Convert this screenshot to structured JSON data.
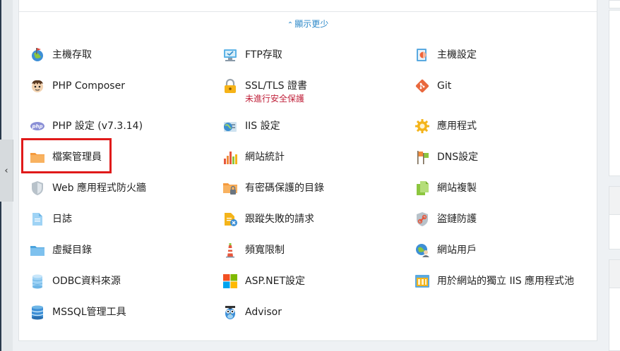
{
  "show_less": {
    "label": "顯示更少",
    "icon": "chevron-up-icon"
  },
  "collapse_icon": "chevron-left-icon",
  "items": [
    {
      "key": "hosting-access",
      "label": "主機存取",
      "icon": "globe-flag-icon"
    },
    {
      "key": "ftp-access",
      "label": "FTP存取",
      "icon": "ftp-monitor-icon"
    },
    {
      "key": "hosting-settings",
      "label": "主機設定",
      "icon": "server-settings-icon"
    },
    {
      "key": "php-composer",
      "label": "PHP Composer",
      "icon": "composer-icon"
    },
    {
      "key": "ssl-tls",
      "label": "SSL/TLS 證書",
      "sublabel": "未進行安全保護",
      "icon": "lock-icon"
    },
    {
      "key": "git",
      "label": "Git",
      "icon": "git-icon"
    },
    {
      "key": "php-settings",
      "label": "PHP 設定 (v7.3.14)",
      "icon": "php-icon"
    },
    {
      "key": "iis-settings",
      "label": "IIS 設定",
      "icon": "iis-icon"
    },
    {
      "key": "applications",
      "label": "應用程式",
      "icon": "gear-icon"
    },
    {
      "key": "file-manager",
      "label": "檔案管理員",
      "icon": "folder-icon"
    },
    {
      "key": "web-statistics",
      "label": "網站統計",
      "icon": "bar-chart-icon"
    },
    {
      "key": "dns-settings",
      "label": "DNS設定",
      "icon": "dns-flags-icon"
    },
    {
      "key": "web-app-firewall",
      "label": "Web 應用程式防火牆",
      "icon": "shield-icon"
    },
    {
      "key": "password-protected-dirs",
      "label": "有密碼保護的目錄",
      "icon": "locked-folder-icon"
    },
    {
      "key": "website-copy",
      "label": "網站複製",
      "icon": "copy-pages-icon"
    },
    {
      "key": "logs",
      "label": "日誌",
      "icon": "document-icon"
    },
    {
      "key": "failed-request-tracing",
      "label": "跟蹤失敗的請求",
      "icon": "trace-document-icon"
    },
    {
      "key": "hotlink-protection",
      "label": "盜鏈防護",
      "icon": "chain-shield-icon"
    },
    {
      "key": "virtual-directories",
      "label": "虛擬目錄",
      "icon": "folder-blue-icon"
    },
    {
      "key": "bandwidth-limiting",
      "label": "頻寬限制",
      "icon": "lighthouse-icon"
    },
    {
      "key": "web-users",
      "label": "網站用戶",
      "icon": "globe-user-icon"
    },
    {
      "key": "odbc-sources",
      "label": "ODBC資料來源",
      "icon": "database-icon"
    },
    {
      "key": "aspnet-settings",
      "label": "ASP.NET設定",
      "icon": "windows-icon"
    },
    {
      "key": "iis-app-pool",
      "label": "用於網站的獨立 IIS 應用程式池",
      "icon": "app-pool-icon"
    },
    {
      "key": "mssql-tools",
      "label": "MSSQL管理工具",
      "icon": "database-stack-icon"
    },
    {
      "key": "advisor",
      "label": "Advisor",
      "icon": "owl-icon"
    }
  ]
}
